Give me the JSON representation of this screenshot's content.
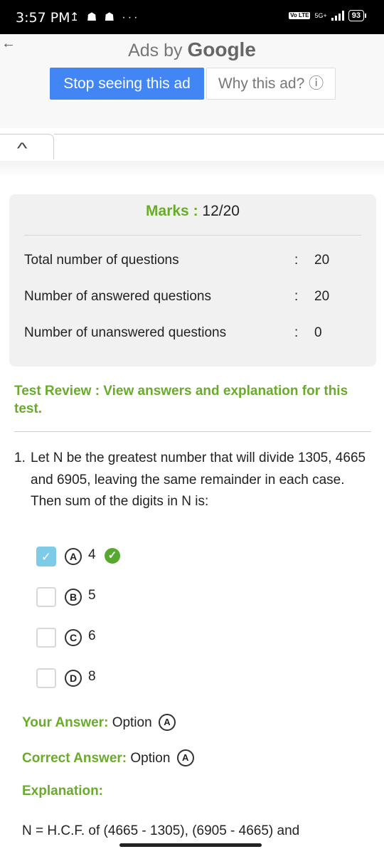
{
  "status_bar": {
    "time": "3:57 PM",
    "notif_icons": "↥ ☗ ☗ ···",
    "volte": "Vo LTE",
    "network": "5G+",
    "battery": "93"
  },
  "ad": {
    "ads_by": "Ads by",
    "google": "Google",
    "stop_button": "Stop seeing this ad",
    "why_button": "Why this ad? ⓘ"
  },
  "marks": {
    "label": "Marks :",
    "value": "12/20",
    "rows": [
      {
        "label": "Total number of questions",
        "colon": ":",
        "value": "20"
      },
      {
        "label": "Number of answered questions",
        "colon": ":",
        "value": "20"
      },
      {
        "label": "Number of unanswered questions",
        "colon": ":",
        "value": "0"
      }
    ]
  },
  "review": {
    "title": "Test Review : View answers and explanation for this test."
  },
  "question": {
    "number": "1.",
    "text": "Let N be the greatest number that will divide 1305, 4665 and 6905, leaving the same remainder in each case. Then sum of the digits in N is:",
    "options": [
      {
        "letter": "A",
        "value": "4"
      },
      {
        "letter": "B",
        "value": "5"
      },
      {
        "letter": "C",
        "value": "6"
      },
      {
        "letter": "D",
        "value": "8"
      }
    ],
    "your_answer_label": "Your Answer:",
    "your_answer_text": "Option",
    "your_answer_letter": "A",
    "correct_answer_label": "Correct Answer:",
    "correct_answer_text": "Option",
    "correct_answer_letter": "A",
    "explanation_label": "Explanation:",
    "explanation_text": "N = H.C.F. of (4665 - 1305), (6905 - 4665) and"
  },
  "colors": {
    "accent_green": "#6aab2b",
    "ad_blue": "#4285f4",
    "checkbox_checked": "#7ecbe7"
  }
}
